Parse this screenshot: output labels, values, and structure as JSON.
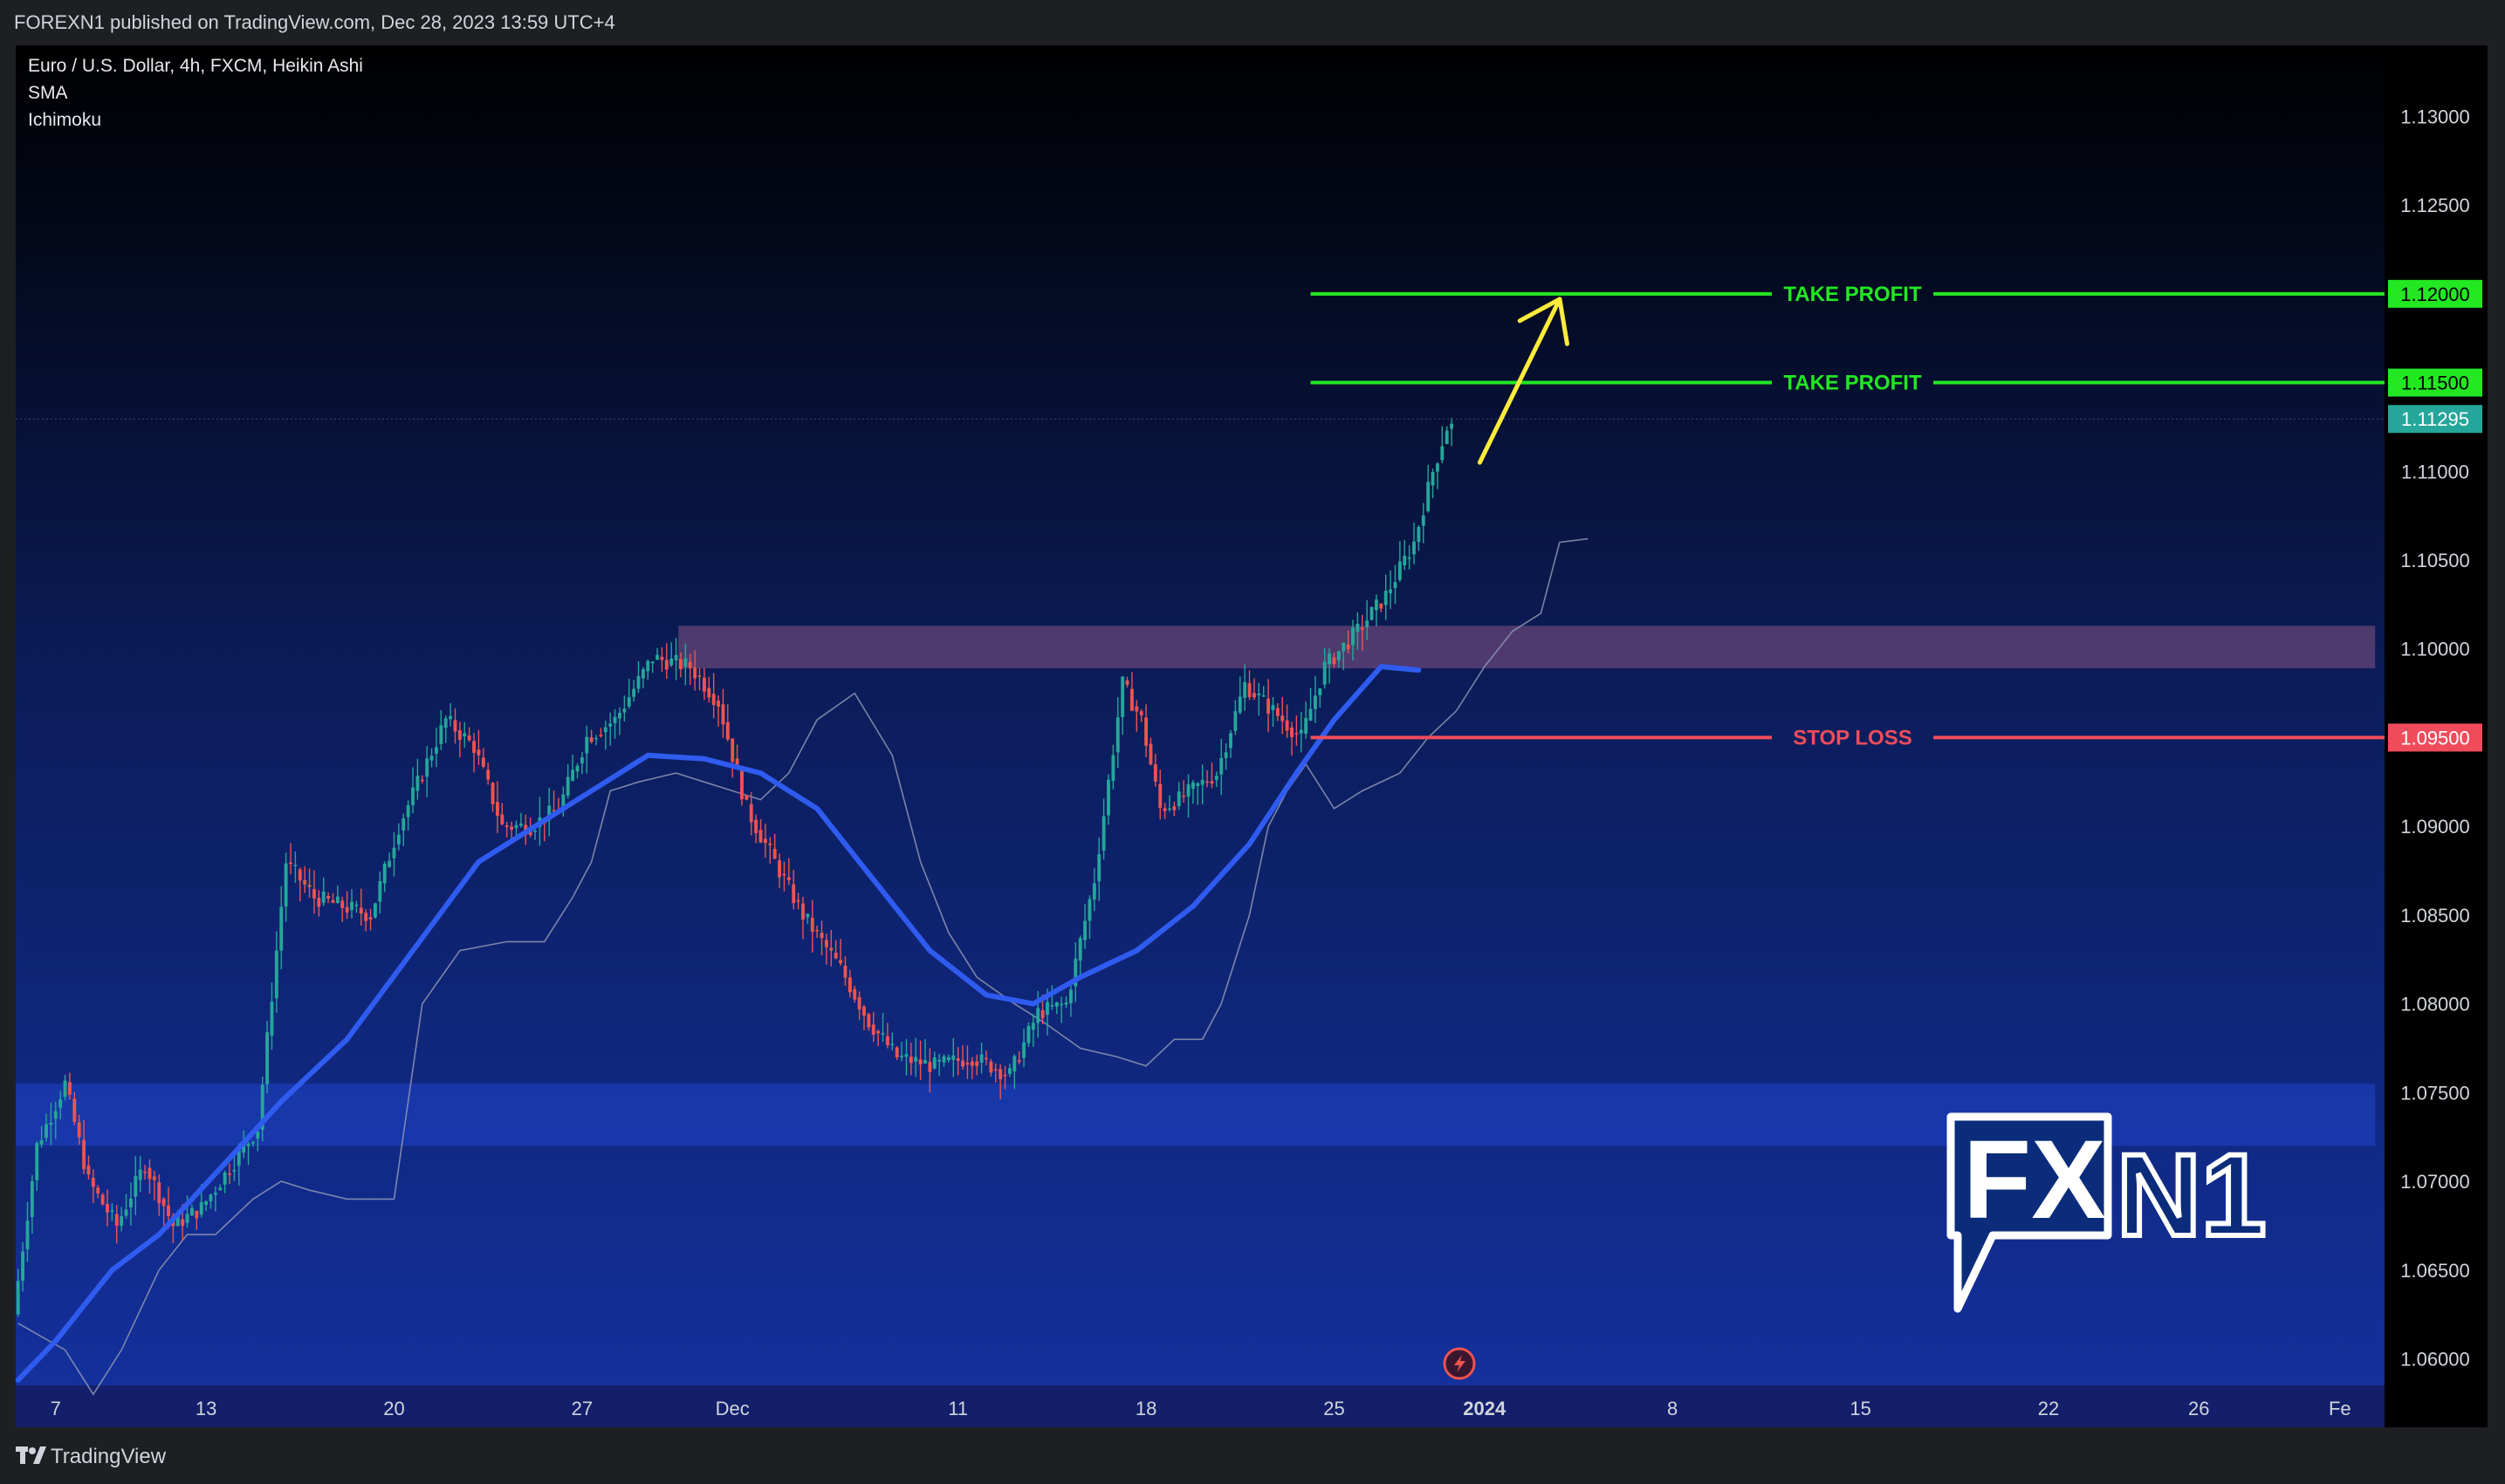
{
  "header": {
    "publish_text": "FOREXN1 published on TradingView.com, Dec 28, 2023 13:59 UTC+4"
  },
  "legend": {
    "symbol": "Euro / U.S. Dollar, 4h, FXCM, Heikin Ashi",
    "indicator1": "SMA",
    "indicator2": "Ichimoku"
  },
  "footer": {
    "brand": "TradingView"
  },
  "watermark": {
    "part1": "FX",
    "part2": "N1"
  },
  "colors": {
    "background_top": "#000000",
    "background_bottom": "#123092",
    "bull": "#26a69a",
    "bear": "#ef5350",
    "sma": "#2f5bef",
    "take_profit": "#22e822",
    "stop_loss": "#f04c5c",
    "arrow": "#ffeb3b",
    "last_price": "#26a69a"
  },
  "chart_data": {
    "type": "candlestick",
    "ylim": [
      1.0585,
      1.134
    ],
    "y_ticks": [
      "1.13000",
      "1.12500",
      "1.11000",
      "1.10500",
      "1.10000",
      "1.09000",
      "1.08500",
      "1.08000",
      "1.07500",
      "1.07000",
      "1.06500",
      "1.06000"
    ],
    "y_tick_values": [
      1.13,
      1.125,
      1.11,
      1.105,
      1.1,
      1.09,
      1.085,
      1.08,
      1.075,
      1.07,
      1.065,
      1.06
    ],
    "x_labels": [
      {
        "label": "7",
        "bar": 8
      },
      {
        "label": "13",
        "bar": 40
      },
      {
        "label": "20",
        "bar": 80
      },
      {
        "label": "27",
        "bar": 120
      },
      {
        "label": "Dec",
        "bar": 152
      },
      {
        "label": "11",
        "bar": 200
      },
      {
        "label": "18",
        "bar": 240
      },
      {
        "label": "25",
        "bar": 280
      },
      {
        "label": "2024",
        "bar": 312
      },
      {
        "label": "8",
        "bar": 352
      },
      {
        "label": "15",
        "bar": 392
      },
      {
        "label": "22",
        "bar": 432
      },
      {
        "label": "26",
        "bar": 464
      },
      {
        "label": "Fe",
        "bar": 494
      }
    ],
    "bars_total_span": 504,
    "key_points": [
      [
        0,
        1.0625
      ],
      [
        5,
        1.072
      ],
      [
        11,
        1.0755
      ],
      [
        16,
        1.07
      ],
      [
        22,
        1.0675
      ],
      [
        28,
        1.071
      ],
      [
        34,
        1.0675
      ],
      [
        40,
        1.0685
      ],
      [
        52,
        1.073
      ],
      [
        58,
        1.088
      ],
      [
        64,
        1.086
      ],
      [
        70,
        1.0855
      ],
      [
        76,
        1.085
      ],
      [
        82,
        1.09
      ],
      [
        92,
        1.096
      ],
      [
        98,
        1.0945
      ],
      [
        104,
        1.09
      ],
      [
        110,
        1.09
      ],
      [
        116,
        1.091
      ],
      [
        122,
        1.095
      ],
      [
        128,
        1.096
      ],
      [
        136,
        1.0995
      ],
      [
        144,
        1.099
      ],
      [
        150,
        1.097
      ],
      [
        156,
        1.091
      ],
      [
        162,
        1.088
      ],
      [
        168,
        1.085
      ],
      [
        176,
        1.082
      ],
      [
        182,
        1.079
      ],
      [
        188,
        1.077
      ],
      [
        196,
        1.0765
      ],
      [
        204,
        1.077
      ],
      [
        212,
        1.076
      ],
      [
        218,
        1.0795
      ],
      [
        224,
        1.08
      ],
      [
        230,
        1.087
      ],
      [
        236,
        1.098
      ],
      [
        240,
        1.096
      ],
      [
        244,
        1.091
      ],
      [
        248,
        1.0915
      ],
      [
        256,
        1.093
      ],
      [
        262,
        1.098
      ],
      [
        268,
        1.0965
      ],
      [
        274,
        1.095
      ],
      [
        279,
        1.099
      ],
      [
        286,
        1.101
      ],
      [
        292,
        1.103
      ],
      [
        298,
        1.106
      ],
      [
        302,
        1.11
      ],
      [
        305,
        1.1125
      ]
    ],
    "sma": [
      [
        0,
        1.0588
      ],
      [
        8,
        1.061
      ],
      [
        20,
        1.065
      ],
      [
        30,
        1.067
      ],
      [
        44,
        1.071
      ],
      [
        56,
        1.0745
      ],
      [
        70,
        1.078
      ],
      [
        84,
        1.083
      ],
      [
        98,
        1.088
      ],
      [
        110,
        1.09
      ],
      [
        122,
        1.092
      ],
      [
        134,
        1.094
      ],
      [
        146,
        1.0938
      ],
      [
        158,
        1.093
      ],
      [
        170,
        1.091
      ],
      [
        182,
        1.087
      ],
      [
        194,
        1.083
      ],
      [
        206,
        1.0805
      ],
      [
        216,
        1.08
      ],
      [
        226,
        1.0815
      ],
      [
        238,
        1.083
      ],
      [
        250,
        1.0855
      ],
      [
        262,
        1.089
      ],
      [
        272,
        1.093
      ],
      [
        280,
        1.096
      ],
      [
        290,
        1.099
      ],
      [
        298,
        1.0988
      ]
    ],
    "ichimoku_line": [
      [
        0,
        1.062
      ],
      [
        10,
        1.0605
      ],
      [
        16,
        1.058
      ],
      [
        22,
        1.0605
      ],
      [
        30,
        1.065
      ],
      [
        36,
        1.067
      ],
      [
        42,
        1.067
      ],
      [
        50,
        1.069
      ],
      [
        56,
        1.07
      ],
      [
        62,
        1.0695
      ],
      [
        70,
        1.069
      ],
      [
        76,
        1.069
      ],
      [
        80,
        1.069
      ],
      [
        86,
        1.08
      ],
      [
        94,
        1.083
      ],
      [
        104,
        1.0835
      ],
      [
        112,
        1.0835
      ],
      [
        118,
        1.086
      ],
      [
        122,
        1.088
      ],
      [
        126,
        1.092
      ],
      [
        132,
        1.0925
      ],
      [
        140,
        1.093
      ],
      [
        146,
        1.0925
      ],
      [
        152,
        1.092
      ],
      [
        158,
        1.0915
      ],
      [
        164,
        1.093
      ],
      [
        170,
        1.096
      ],
      [
        178,
        1.0975
      ],
      [
        186,
        1.094
      ],
      [
        192,
        1.088
      ],
      [
        198,
        1.084
      ],
      [
        204,
        1.0815
      ],
      [
        212,
        1.08
      ],
      [
        218,
        1.079
      ],
      [
        226,
        1.0775
      ],
      [
        234,
        1.077
      ],
      [
        240,
        1.0765
      ],
      [
        246,
        1.078
      ],
      [
        252,
        1.078
      ],
      [
        256,
        1.08
      ],
      [
        262,
        1.085
      ],
      [
        266,
        1.09
      ],
      [
        270,
        1.092
      ],
      [
        274,
        1.0935
      ],
      [
        280,
        1.091
      ],
      [
        286,
        1.092
      ],
      [
        294,
        1.093
      ],
      [
        300,
        1.095
      ],
      [
        306,
        1.0965
      ],
      [
        312,
        1.099
      ],
      [
        318,
        1.101
      ],
      [
        324,
        1.102
      ],
      [
        328,
        1.106
      ],
      [
        334,
        1.1062
      ]
    ],
    "zones": [
      {
        "name": "resistance-zone",
        "from_bar": 141,
        "to_bar": 502,
        "top": 1.1013,
        "bottom": 1.0989,
        "color": "#5a3f72"
      },
      {
        "name": "support-zone",
        "from_bar": 0,
        "to_bar": 502,
        "top": 1.0755,
        "bottom": 1.072,
        "color": "#1a3ab0"
      }
    ],
    "levels": [
      {
        "label": "TAKE PROFIT",
        "value": 1.12,
        "price_label": "1.12000",
        "kind": "take_profit"
      },
      {
        "label": "TAKE PROFIT",
        "value": 1.115,
        "price_label": "1.11500",
        "kind": "take_profit"
      },
      {
        "label": "STOP LOSS",
        "value": 1.095,
        "price_label": "1.09500",
        "kind": "stop_loss"
      }
    ],
    "level_start_bar": 275,
    "last_price": {
      "value": 1.11295,
      "label": "1.11295"
    },
    "arrow": {
      "from_bar": 311,
      "from_y": 1.1105,
      "to_bar": 328,
      "to_y": 1.1197
    }
  }
}
